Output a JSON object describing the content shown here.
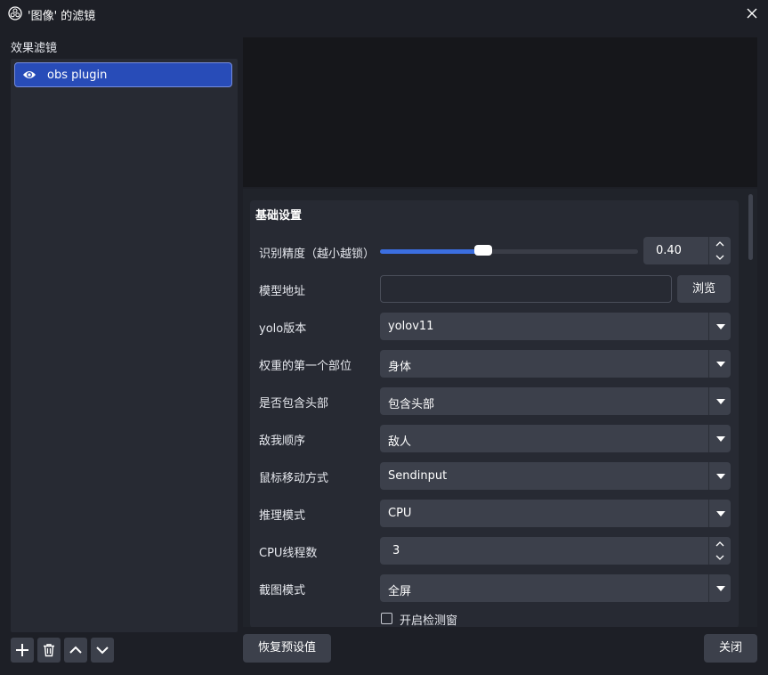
{
  "window": {
    "title": "'图像' 的滤镜"
  },
  "filters": {
    "label": "效果滤镜",
    "items": [
      {
        "name": "obs plugin",
        "visible": true
      }
    ]
  },
  "properties": {
    "group_title": "基础设置",
    "precision": {
      "label": "识别精度（越小越锁）",
      "value": "0.40",
      "slider_fraction": 0.4
    },
    "model_path": {
      "label": "模型地址",
      "value": "",
      "browse_label": "浏览"
    },
    "yolo_version": {
      "label": "yolo版本",
      "value": "yolov11"
    },
    "first_weight": {
      "label": "权重的第一个部位",
      "value": "身体"
    },
    "include_head": {
      "label": "是否包含头部",
      "value": "包含头部"
    },
    "enemy_order": {
      "label": "敌我顺序",
      "value": "敌人"
    },
    "mouse_move": {
      "label": "鼠标移动方式",
      "value": "Sendinput"
    },
    "inference": {
      "label": "推理模式",
      "value": "CPU"
    },
    "cpu_threads": {
      "label": "CPU线程数",
      "value": "3"
    },
    "capture": {
      "label": "截图模式",
      "value": "全屏"
    },
    "detect_window": {
      "label": "开启检测窗",
      "checked": false
    }
  },
  "buttons": {
    "restore_defaults": "恢复预设值",
    "close": "关闭"
  },
  "colors": {
    "accent": "#284cb8",
    "slider_fill": "#3b6ee0",
    "background": "#1d1f26"
  }
}
